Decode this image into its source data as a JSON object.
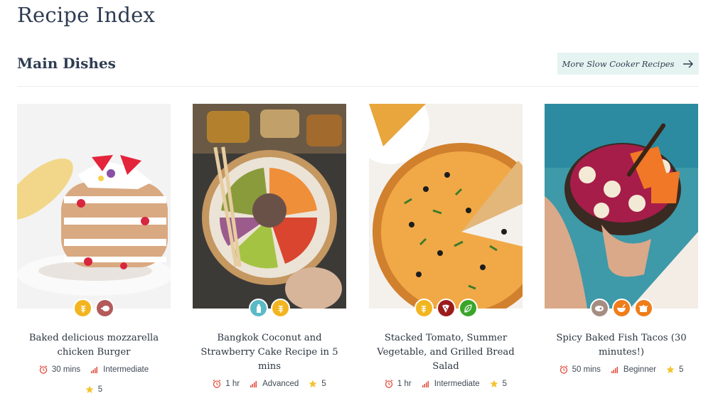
{
  "page": {
    "title": "Recipe Index"
  },
  "section": {
    "title": "Main Dishes",
    "more_label": "More Slow Cooker Recipes"
  },
  "colors": {
    "accent_bg": "#e6f4f1",
    "yellow": "#f2b51f",
    "red": "#e24b3b"
  },
  "cards": [
    {
      "title": "Baked delicious mozzarella chicken Burger",
      "time": "30 mins",
      "difficulty": "Intermediate",
      "rating": "5",
      "badges": [
        {
          "icon": "wheat-icon",
          "color": "#f2b51f"
        },
        {
          "icon": "chicken-icon",
          "color": "#b35a5a"
        }
      ]
    },
    {
      "title": "Bangkok Coconut and Strawberry Cake Recipe in 5 mins",
      "time": "1 hr",
      "difficulty": "Advanced",
      "rating": "5",
      "badges": [
        {
          "icon": "milk-bottle-icon",
          "color": "#5bbac6"
        },
        {
          "icon": "wheat-icon",
          "color": "#f2b51f"
        }
      ]
    },
    {
      "title": "Stacked Tomato, Summer Vegetable, and Grilled Bread Salad",
      "time": "1 hr",
      "difficulty": "Intermediate",
      "rating": "5",
      "badges": [
        {
          "icon": "wheat-icon",
          "color": "#f2b51f"
        },
        {
          "icon": "pizza-icon",
          "color": "#9c1b1b"
        },
        {
          "icon": "leaf-icon",
          "color": "#3aa52a"
        }
      ]
    },
    {
      "title": "Spicy Baked Fish Tacos (30 minutes!)",
      "time": "50 mins",
      "difficulty": "Beginner",
      "rating": "5",
      "badges": [
        {
          "icon": "meat-icon",
          "color": "#a58d82"
        },
        {
          "icon": "bowl-icon",
          "color": "#ef7d1a"
        },
        {
          "icon": "pot-icon",
          "color": "#ef7d1a"
        }
      ]
    }
  ]
}
